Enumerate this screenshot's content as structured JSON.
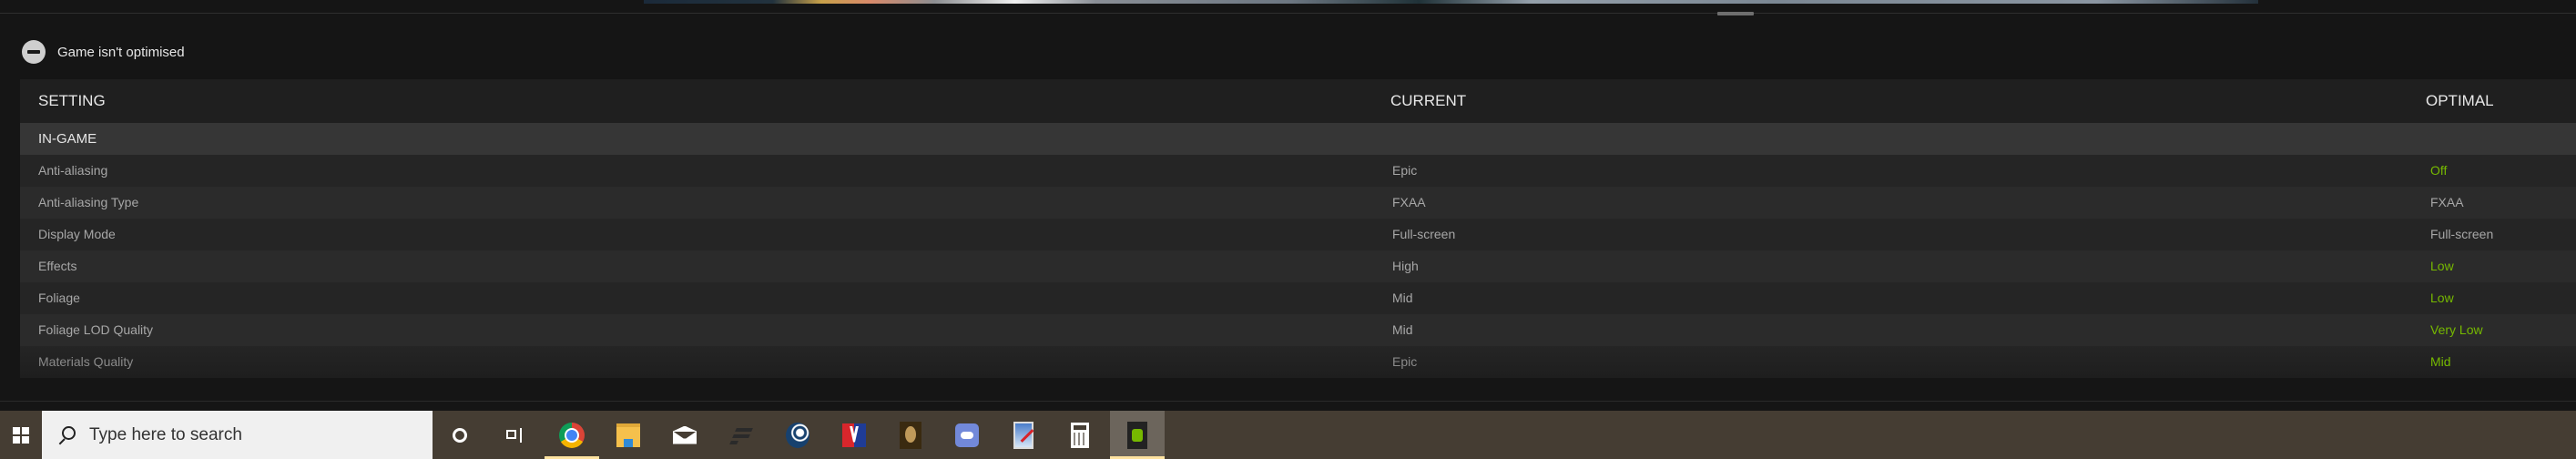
{
  "status": {
    "icon": "not-optimised-icon",
    "text": "Game isn't optimised"
  },
  "table": {
    "headers": {
      "setting": "SETTING",
      "current": "CURRENT",
      "optimal": "OPTIMAL"
    },
    "group_label": "IN-GAME",
    "rows": [
      {
        "setting": "Anti-aliasing",
        "current": "Epic",
        "optimal": "Off",
        "changed": true
      },
      {
        "setting": "Anti-aliasing Type",
        "current": "FXAA",
        "optimal": "FXAA",
        "changed": false
      },
      {
        "setting": "Display Mode",
        "current": "Full-screen",
        "optimal": "Full-screen",
        "changed": false
      },
      {
        "setting": "Effects",
        "current": "High",
        "optimal": "Low",
        "changed": true
      },
      {
        "setting": "Foliage",
        "current": "Mid",
        "optimal": "Low",
        "changed": true
      },
      {
        "setting": "Foliage LOD Quality",
        "current": "Mid",
        "optimal": "Very Low",
        "changed": true
      },
      {
        "setting": "Materials Quality",
        "current": "Epic",
        "optimal": "Mid",
        "changed": true
      }
    ],
    "colors": {
      "changed": "#76b900",
      "unchanged": "#a7a7a7"
    }
  },
  "taskbar": {
    "search_placeholder": "Type here to search",
    "apps": [
      {
        "name": "chrome",
        "active": false,
        "running": true
      },
      {
        "name": "file-explorer",
        "active": false,
        "running": false
      },
      {
        "name": "mail",
        "active": false,
        "running": false
      },
      {
        "name": "epic-games",
        "active": false,
        "running": false
      },
      {
        "name": "steam",
        "active": false,
        "running": false
      },
      {
        "name": "iracing",
        "active": false,
        "running": false
      },
      {
        "name": "rocksmith",
        "active": false,
        "running": false
      },
      {
        "name": "discord",
        "active": false,
        "running": false
      },
      {
        "name": "paint",
        "active": false,
        "running": false
      },
      {
        "name": "calculator",
        "active": false,
        "running": false
      },
      {
        "name": "geforce-experience",
        "active": true,
        "running": true
      }
    ]
  }
}
